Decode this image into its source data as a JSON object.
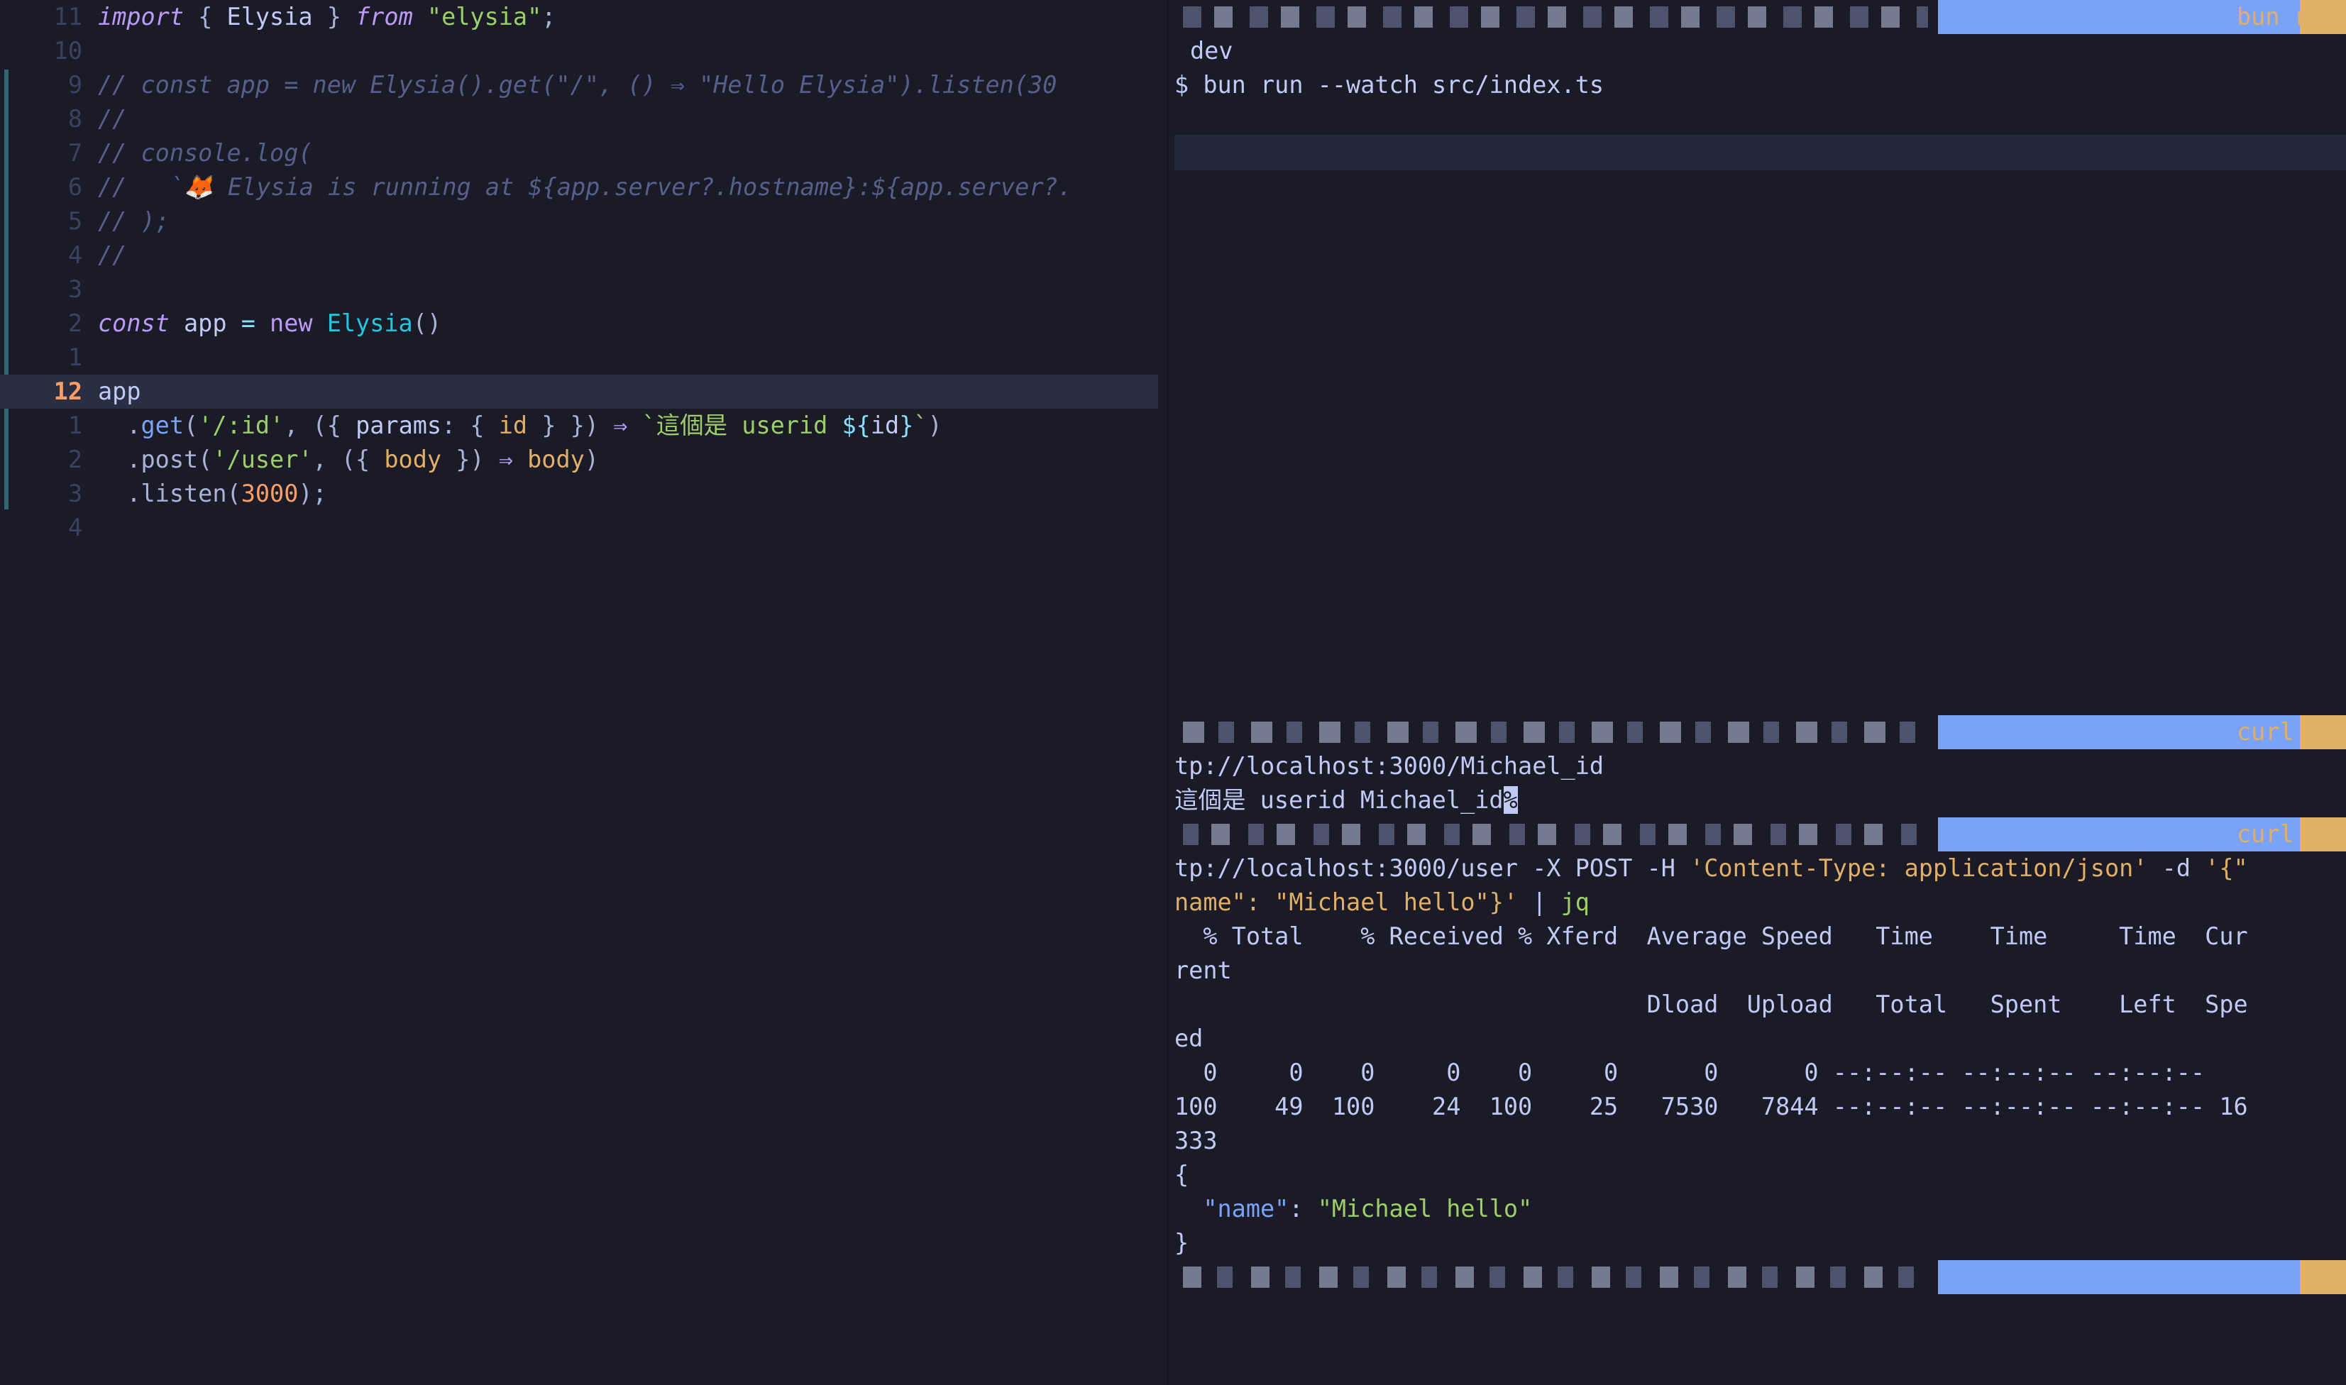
{
  "editor": {
    "lines": [
      {
        "num": "11",
        "tokens": [
          {
            "t": "import",
            "c": "kw"
          },
          {
            "t": " { ",
            "c": "punc"
          },
          {
            "t": "Elysia",
            "c": "var"
          },
          {
            "t": " } ",
            "c": "punc"
          },
          {
            "t": "from",
            "c": "kw"
          },
          {
            "t": " ",
            "c": "var"
          },
          {
            "t": "\"elysia\"",
            "c": "str"
          },
          {
            "t": ";",
            "c": "punc"
          }
        ]
      },
      {
        "num": "10",
        "tokens": []
      },
      {
        "num": "9",
        "tokens": [
          {
            "t": "// const app = new Elysia().get(\"/\", () ⇒ \"Hello Elysia\").listen(30",
            "c": "cm"
          }
        ]
      },
      {
        "num": "8",
        "tokens": [
          {
            "t": "//",
            "c": "cm"
          }
        ]
      },
      {
        "num": "7",
        "tokens": [
          {
            "t": "// console.log(",
            "c": "cm"
          }
        ]
      },
      {
        "num": "6",
        "tokens": [
          {
            "t": "//   `🦊 Elysia is running at ${app.server?.hostname}:${app.server?.",
            "c": "cm"
          }
        ]
      },
      {
        "num": "5",
        "tokens": [
          {
            "t": "// );",
            "c": "cm"
          }
        ]
      },
      {
        "num": "4",
        "tokens": [
          {
            "t": "//",
            "c": "cm"
          }
        ]
      },
      {
        "num": "3",
        "tokens": []
      },
      {
        "num": "2",
        "tokens": [
          {
            "t": "const",
            "c": "kw"
          },
          {
            "t": " app ",
            "c": "var"
          },
          {
            "t": "=",
            "c": "op"
          },
          {
            "t": " ",
            "c": "var"
          },
          {
            "t": "new",
            "c": "kw2"
          },
          {
            "t": " ",
            "c": "var"
          },
          {
            "t": "Elysia",
            "c": "cls"
          },
          {
            "t": "()",
            "c": "punc"
          }
        ]
      },
      {
        "num": "1",
        "tokens": []
      },
      {
        "num": "12",
        "current": true,
        "tokens": [
          {
            "t": "app",
            "c": "var"
          }
        ]
      },
      {
        "num": "1",
        "tokens": [
          {
            "t": "  .",
            "c": "punc"
          },
          {
            "t": "get",
            "c": "fn"
          },
          {
            "t": "(",
            "c": "punc"
          },
          {
            "t": "'/:id'",
            "c": "str"
          },
          {
            "t": ", ({ ",
            "c": "punc"
          },
          {
            "t": "params",
            "c": "var"
          },
          {
            "t": ": { ",
            "c": "punc"
          },
          {
            "t": "id",
            "c": "par"
          },
          {
            "t": " } }) ",
            "c": "punc"
          },
          {
            "t": "⇒",
            "c": "kw2"
          },
          {
            "t": " ",
            "c": "var"
          },
          {
            "t": "`這個是 userid ",
            "c": "str"
          },
          {
            "t": "${",
            "c": "op"
          },
          {
            "t": "id",
            "c": "var"
          },
          {
            "t": "}",
            "c": "op"
          },
          {
            "t": "`",
            "c": "str"
          },
          {
            "t": ")",
            "c": "punc"
          }
        ]
      },
      {
        "num": "2",
        "tokens": [
          {
            "t": "  .post(",
            "c": "punc"
          },
          {
            "t": "'/user'",
            "c": "str"
          },
          {
            "t": ", ({ ",
            "c": "punc"
          },
          {
            "t": "body",
            "c": "par"
          },
          {
            "t": " }) ",
            "c": "punc"
          },
          {
            "t": "⇒",
            "c": "kw2"
          },
          {
            "t": " ",
            "c": "var"
          },
          {
            "t": "body",
            "c": "par"
          },
          {
            "t": ")",
            "c": "punc"
          }
        ]
      },
      {
        "num": "3",
        "tokens": [
          {
            "t": "  .listen(",
            "c": "punc"
          },
          {
            "t": "3000",
            "c": "num"
          },
          {
            "t": ");",
            "c": "punc"
          }
        ]
      },
      {
        "num": "4",
        "tokens": []
      }
    ]
  },
  "terminal": {
    "prompt1_cmd": "bun run",
    "t_dev": "dev",
    "t_bun_cmd": "$ bun run --watch src/index.ts",
    "prompt2_cmd": "curl ht",
    "t_curl1_url": "tp://localhost:3000/Michael_id",
    "t_resp1_text": "這個是 userid Michael_id",
    "t_resp1_pct": "%",
    "prompt3_cmd": "curl ht",
    "t_curl2_a": "tp://localhost:3000/user -X POST -H ",
    "t_curl2_b": "'Content-Type: application/json'",
    "t_curl2_c": " -d ",
    "t_curl2_d": "'{\"",
    "t_curl2_e": "name\": \"Michael hello\"}'",
    "t_curl2_f": " | ",
    "t_curl2_g": "jq",
    "t_stats1": "  % Total    % Received % Xferd  Average Speed   Time    Time     Time  Cur",
    "t_stats2": "rent",
    "t_stats3": "                                 Dload  Upload   Total   Spent    Left  Spe",
    "t_stats4": "ed",
    "t_stats5": "  0     0    0     0    0     0      0      0 --:--:-- --:--:-- --:--:--",
    "t_stats6": "100    49  100    24  100    25   7530   7844 --:--:-- --:--:-- --:--:-- 16",
    "t_stats7": "333",
    "t_json_open": "{",
    "t_json_key": "\"name\"",
    "t_json_colon": ": ",
    "t_json_val": "\"Michael hello\"",
    "t_json_close": "}"
  },
  "colors": {
    "background": "#1a1b26",
    "prompt_blue": "#7aa2f7",
    "prompt_gold": "#e0af68",
    "comment": "#565f89",
    "current_line_number": "#ff9e64"
  }
}
